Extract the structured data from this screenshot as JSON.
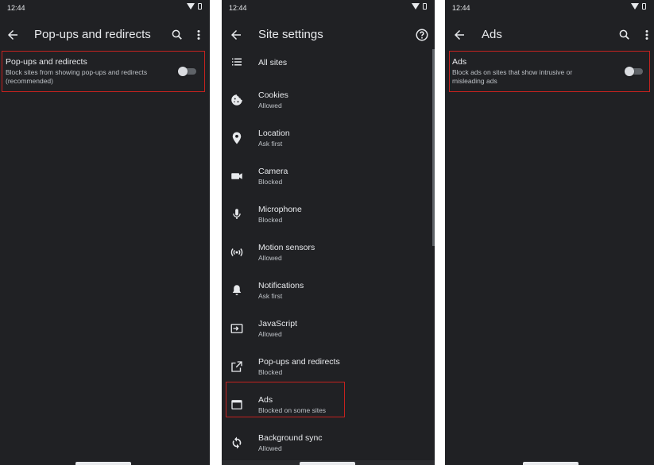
{
  "panels": [
    {
      "status": {
        "time": "12:44"
      },
      "appbar": {
        "title": "Pop-ups and redirects"
      },
      "pref": {
        "title": "Pop-ups and redirects",
        "summary": "Block sites from showing pop-ups and redirects (recommended)",
        "toggle_on": false
      }
    },
    {
      "status": {
        "time": "12:44"
      },
      "appbar": {
        "title": "Site settings"
      },
      "items": [
        {
          "label": "All sites",
          "sub": "",
          "icon": "list-icon"
        },
        {
          "label": "Cookies",
          "sub": "Allowed",
          "icon": "cookie-icon"
        },
        {
          "label": "Location",
          "sub": "Ask first",
          "icon": "location-pin-icon"
        },
        {
          "label": "Camera",
          "sub": "Blocked",
          "icon": "camera-icon"
        },
        {
          "label": "Microphone",
          "sub": "Blocked",
          "icon": "microphone-icon"
        },
        {
          "label": "Motion sensors",
          "sub": "Allowed",
          "icon": "motion-sensors-icon"
        },
        {
          "label": "Notifications",
          "sub": "Ask first",
          "icon": "bell-icon"
        },
        {
          "label": "JavaScript",
          "sub": "Allowed",
          "icon": "javascript-icon"
        },
        {
          "label": "Pop-ups and redirects",
          "sub": "Blocked",
          "icon": "open-in-new-icon"
        },
        {
          "label": "Ads",
          "sub": "Blocked on some sites",
          "icon": "ads-window-icon"
        },
        {
          "label": "Background sync",
          "sub": "Allowed",
          "icon": "sync-icon"
        }
      ]
    },
    {
      "status": {
        "time": "12:44"
      },
      "appbar": {
        "title": "Ads"
      },
      "pref": {
        "title": "Ads",
        "summary": "Block ads on sites that show intrusive or misleading ads",
        "toggle_on": false
      }
    }
  ],
  "colors": {
    "background": "#202124",
    "text": "#e8eaed",
    "secondary_text": "#bdc1c6",
    "highlight": "#c5221f"
  }
}
